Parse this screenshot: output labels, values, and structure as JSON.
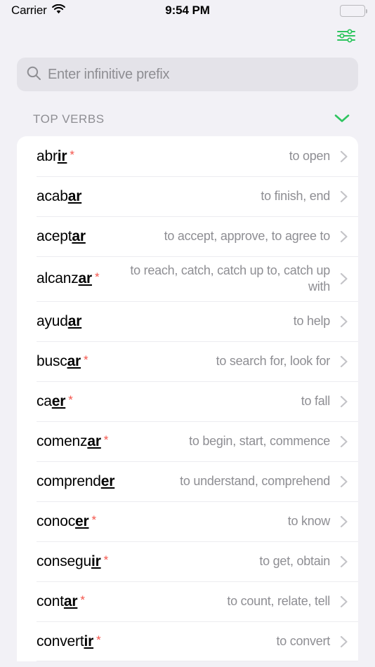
{
  "status_bar": {
    "carrier": "Carrier",
    "wifi_icon": "wifi-icon",
    "time": "9:54 PM",
    "battery_icon": "battery-full-icon"
  },
  "toolbar": {
    "filter_icon": "sliders-filter-icon",
    "filter_color": "#2ec45f"
  },
  "search": {
    "icon": "search-icon",
    "placeholder": "Enter infinitive prefix",
    "value": ""
  },
  "section": {
    "title": "TOP VERBS",
    "toggle_icon": "chevron-down-icon",
    "toggle_color": "#2ec45f"
  },
  "colors": {
    "page_background": "#f2f1f6",
    "card_background": "#ffffff",
    "search_background": "#e4e3e9",
    "accent_green": "#2ec45f",
    "irregular_star": "#f4534a",
    "secondary_text": "#8e8e93",
    "separator": "#ececf0"
  },
  "verbs": [
    {
      "stem": "abr",
      "ending": "ir",
      "irregular": "*",
      "definition": "to open"
    },
    {
      "stem": "acab",
      "ending": "ar",
      "irregular": "",
      "definition": "to finish, end"
    },
    {
      "stem": "acept",
      "ending": "ar",
      "irregular": "",
      "definition": "to accept, approve, to agree to"
    },
    {
      "stem": "alcanz",
      "ending": "ar",
      "irregular": "*",
      "definition": "to reach, catch, catch up to, catch up with"
    },
    {
      "stem": "ayud",
      "ending": "ar",
      "irregular": "",
      "definition": "to help"
    },
    {
      "stem": "busc",
      "ending": "ar",
      "irregular": "*",
      "definition": "to search for, look for"
    },
    {
      "stem": "ca",
      "ending": "er",
      "irregular": "*",
      "definition": "to fall"
    },
    {
      "stem": "comenz",
      "ending": "ar",
      "irregular": "*",
      "definition": "to begin, start, commence"
    },
    {
      "stem": "comprend",
      "ending": "er",
      "irregular": "",
      "definition": "to understand, comprehend"
    },
    {
      "stem": "conoc",
      "ending": "er",
      "irregular": "*",
      "definition": "to know"
    },
    {
      "stem": "consegu",
      "ending": "ir",
      "irregular": "*",
      "definition": "to get, obtain"
    },
    {
      "stem": "cont",
      "ending": "ar",
      "irregular": "*",
      "definition": "to count, relate, tell"
    },
    {
      "stem": "convert",
      "ending": "ir",
      "irregular": "*",
      "definition": "to convert"
    }
  ]
}
